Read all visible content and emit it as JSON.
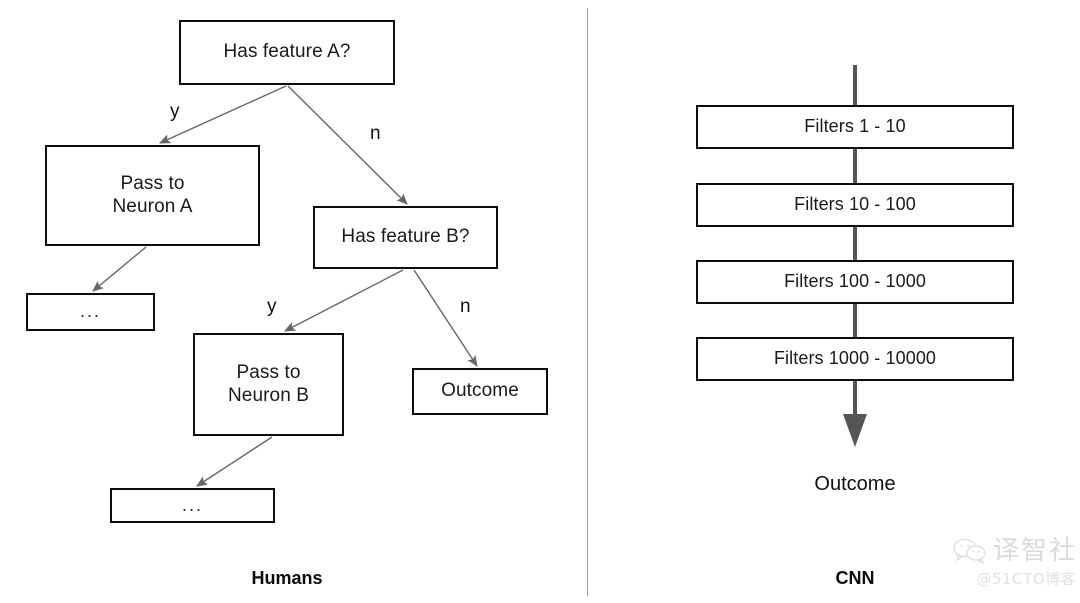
{
  "figure": {
    "left_caption": "Humans",
    "right_caption": "CNN"
  },
  "humans": {
    "nodes": [
      {
        "id": "root",
        "label": "Has feature A?"
      },
      {
        "id": "neuron_a",
        "label": "Pass to\nNeuron A"
      },
      {
        "id": "feature_b",
        "label": "Has feature B?"
      },
      {
        "id": "dots_a",
        "label": "..."
      },
      {
        "id": "neuron_b",
        "label": "Pass to\nNeuron B"
      },
      {
        "id": "outcome",
        "label": "Outcome"
      },
      {
        "id": "dots_b",
        "label": "..."
      }
    ],
    "edge_labels": {
      "a_yes": "y",
      "a_no": "n",
      "b_yes": "y",
      "b_no": "n"
    }
  },
  "cnn": {
    "layers": [
      {
        "label": "Filters 1 - 10"
      },
      {
        "label": "Filters 10 - 100"
      },
      {
        "label": "Filters 100 - 1000"
      },
      {
        "label": "Filters 1000 - 10000"
      }
    ],
    "outcome_label": "Outcome"
  },
  "watermark": {
    "brand": "译智社",
    "handle": "@51CTO博客"
  },
  "colors": {
    "box_border": "#0d0d0d",
    "edge_stroke": "#666666",
    "trunk_arrow": "#555555",
    "divider": "#9a9a9a",
    "background": "#ffffff",
    "watermark_text": "#b9bcc2"
  }
}
